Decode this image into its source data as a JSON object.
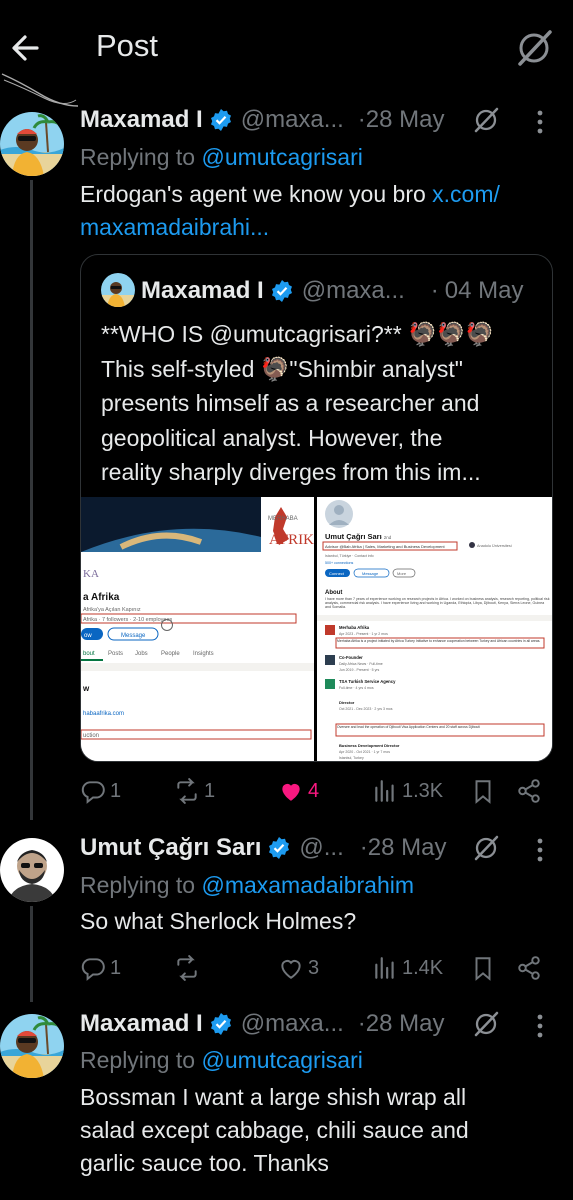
{
  "header": {
    "title": "Post"
  },
  "tweets": [
    {
      "name": "Maxamad I",
      "handle": "@maxa...",
      "dot": "·",
      "date": "28 May",
      "reply_prefix": "Replying to",
      "reply_handle": "@umutcagrisari",
      "text": "Erdogan's agent we know you bro",
      "link": "x.com/",
      "link2": "maxamadaibrahi...",
      "quote": {
        "name": "Maxamad I",
        "handle": "@maxa...",
        "dot": "·",
        "date": "04 May",
        "lines": [
          "**WHO IS @umutcagrisari?** 🦃🦃🦃",
          "This self-styled 🦃\"Shimbir analyst\"",
          "presents himself as a researcher and",
          "geopolitical analyst. However, the",
          "reality sharply diverges from this im..."
        ],
        "img1": {
          "brand_prefix": "MERHABA",
          "brand_main": "AFRIK",
          "brand_left": "KA",
          "page_name": "a Afrika",
          "tagline": "Afrika'ya Açılan Kapınız",
          "followers": "Afrika · 7 followers · 2-10 employees",
          "follow_label": "ow",
          "message_label": "Message",
          "tabs": [
            "bout",
            "Posts",
            "Jobs",
            "People",
            "Insights"
          ],
          "section": "w",
          "website": "habaafrika.com",
          "industry": "uction"
        },
        "img2": {
          "profile_name": "Umut Çağrı Sarı",
          "pronoun": "· 2nd",
          "headline": "Advisor @Bab Afrika | Sales, Marketing and Business Development",
          "location": "Istanbul, Türkiye · Contact info",
          "connections": "500+ connections",
          "school": "Anadolu Üniversitesi",
          "connect_label": "Connect",
          "message_label": "Message",
          "more_label": "More",
          "about_title": "About",
          "about_text": "I have more than 7 years of experience working on research projects in Africa. I worked on business analysis, research reporting, political risk analysis, commercial risk analysis. I have experience living and working in Uganda, Ethiopia, Libya, Djibouti, Kenya, Sierra Leone, Guinea and Somalia.",
          "exp": [
            {
              "title": "Merhaba Afrika",
              "sub": "Apr 2023 - Present · 1 yr 2 mos",
              "desc": "Merhaba Afrika is a project initiated by Africa Turkey Initiative to enhance cooperation between Turkey and African countries in all areas."
            },
            {
              "title": "Co-Founder",
              "sub": "Daily Africa News · Full-time",
              "desc": "Jun 2019 - Present · 5 yrs"
            },
            {
              "title": "TSA Turkish Service Agency",
              "sub": "Full-time · 4 yrs 4 mos",
              "desc": "Director"
            },
            {
              "title": "Director",
              "sub": "Oct 2021 - Dec 2023 · 2 yrs 3 mos",
              "desc": "Oversee and lead the operation of Djibouti Visa Application Centers and 20 staff across Djibouti"
            },
            {
              "title": "Business Development Director",
              "sub": "Apr 2020 - Oct 2021 · 1 yr 7 mos",
              "desc": "Istanbul, Turkey"
            }
          ]
        }
      },
      "actions": {
        "reply": "1",
        "repost": "1",
        "like": "4",
        "views": "1.3K"
      }
    },
    {
      "name": "Umut Çağrı Sarı",
      "handle": "@...",
      "dot": "·",
      "date": "28 May",
      "reply_prefix": "Replying to",
      "reply_handle": "@maxamadaibrahim",
      "text": "So what Sherlock Holmes?",
      "actions": {
        "reply": "1",
        "repost": "",
        "like": "3",
        "views": "1.4K"
      }
    },
    {
      "name": "Maxamad I",
      "handle": "@maxa...",
      "dot": "·",
      "date": "28 May",
      "reply_prefix": "Replying to",
      "reply_handle": "@umutcagrisari",
      "lines": [
        "Bossman I want a large shish wrap all",
        "salad except cabbage, chili sauce and",
        "garlic sauce too. Thanks"
      ]
    }
  ],
  "colors": {
    "accent": "#1d9bf0",
    "like": "#f91880",
    "muted": "#71767b",
    "text": "#e7e9ea",
    "bg": "#000000"
  },
  "icons": [
    "back-arrow-icon",
    "grok-icon",
    "verified-badge-icon",
    "more-icon",
    "reply-icon",
    "repost-icon",
    "like-icon",
    "views-icon",
    "bookmark-icon",
    "share-icon"
  ]
}
